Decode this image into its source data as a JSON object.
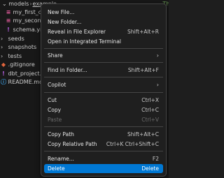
{
  "breadcrumb": {
    "parent": "models",
    "current": "example"
  },
  "editor_hint": "-- Th",
  "tree": [
    {
      "label": "my_first_db",
      "icon": "database-icon",
      "kind": "sql",
      "chevron": ""
    },
    {
      "label": "my_second",
      "icon": "database-icon",
      "kind": "sql",
      "chevron": ""
    },
    {
      "label": "schema.yml",
      "icon": "exclamation-icon",
      "kind": "yml",
      "chevron": ""
    },
    {
      "label": "seeds",
      "icon": "chevron-right-icon",
      "kind": "folder",
      "chevron": "›"
    },
    {
      "label": "snapshots",
      "icon": "chevron-right-icon",
      "kind": "folder",
      "chevron": "›"
    },
    {
      "label": "tests",
      "icon": "chevron-right-icon",
      "kind": "folder",
      "chevron": "›"
    },
    {
      "label": ".gitignore",
      "icon": "git-icon",
      "kind": "git",
      "chevron": ""
    },
    {
      "label": "dbt_project.y",
      "icon": "exclamation-icon",
      "kind": "yml",
      "chevron": ""
    },
    {
      "label": "README.md",
      "icon": "info-icon",
      "kind": "md",
      "chevron": ""
    }
  ],
  "menu": {
    "new_file": {
      "label": "New File..."
    },
    "new_folder": {
      "label": "New Folder..."
    },
    "reveal": {
      "label": "Reveal in File Explorer",
      "key": "Shift+Alt+R"
    },
    "terminal": {
      "label": "Open in Integrated Terminal"
    },
    "share": {
      "label": "Share",
      "arrow": "›"
    },
    "find": {
      "label": "Find in Folder...",
      "key": "Shift+Alt+F"
    },
    "copilot": {
      "label": "Copilot",
      "arrow": "›"
    },
    "cut": {
      "label": "Cut",
      "key": "Ctrl+X"
    },
    "copy": {
      "label": "Copy",
      "key": "Ctrl+C"
    },
    "paste": {
      "label": "Paste",
      "key": "Ctrl+V"
    },
    "copy_path": {
      "label": "Copy Path",
      "key": "Shift+Alt+C"
    },
    "copy_rel": {
      "label": "Copy Relative Path",
      "key": "Ctrl+K Ctrl+Shift+C"
    },
    "rename": {
      "label": "Rename...",
      "key": "F2"
    },
    "delete": {
      "label": "Delete",
      "key": "Delete"
    }
  },
  "colors": {
    "menu_bg": "#1f1f1f",
    "selected_bg": "#0078d4",
    "sql_icon": "#e05a9a",
    "yml_icon": "#b55ee0",
    "git_icon": "#e0643c",
    "md_icon": "#3c9ee0"
  }
}
